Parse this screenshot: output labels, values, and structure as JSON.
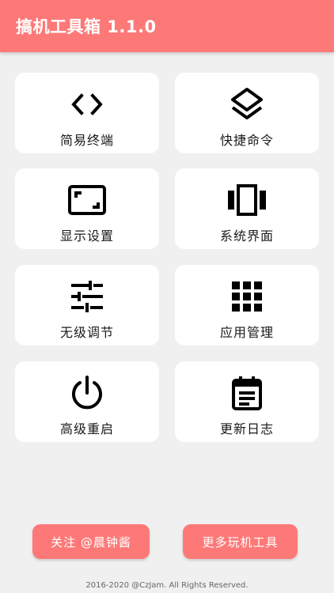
{
  "appbar": {
    "title": "搞机工具箱 1.1.0"
  },
  "colors": {
    "accent": "#fd7978",
    "card": "#ffffff",
    "background": "#f0f0f0"
  },
  "tools": [
    {
      "label": "简易终端",
      "icon": "code-brackets-icon"
    },
    {
      "label": "快捷命令",
      "icon": "layers-icon"
    },
    {
      "label": "显示设置",
      "icon": "aspect-ratio-icon"
    },
    {
      "label": "系统界面",
      "icon": "view-carousel-icon"
    },
    {
      "label": "无级调节",
      "icon": "tune-sliders-icon"
    },
    {
      "label": "应用管理",
      "icon": "apps-grid-icon"
    },
    {
      "label": "高级重启",
      "icon": "power-icon"
    },
    {
      "label": "更新日志",
      "icon": "calendar-notes-icon"
    }
  ],
  "actions": {
    "follow_label": "关注 @晨钟酱",
    "more_label": "更多玩机工具"
  },
  "footer": {
    "copyright": "2016-2020 @CzJam. All Rights Reserved."
  }
}
